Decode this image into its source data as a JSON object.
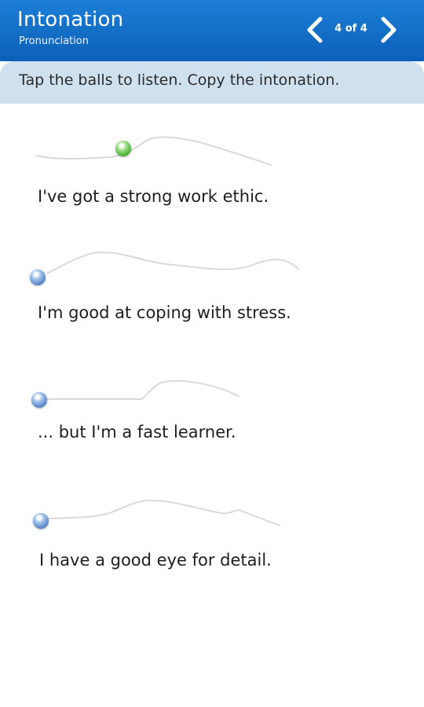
{
  "header": {
    "title": "Intonation",
    "subtitle": "Pronunciation",
    "page_count": "4 of 4"
  },
  "instruction": "Tap the balls to listen. Copy the intonation.",
  "items": [
    {
      "text": "I've got a strong work ethic.",
      "ball_color": "green"
    },
    {
      "text": "I'm good at coping with stress.",
      "ball_color": "blue"
    },
    {
      "text": "... but I'm a fast learner.",
      "ball_color": "blue"
    },
    {
      "text": "I have a good eye for detail.",
      "ball_color": "blue"
    }
  ],
  "colors": {
    "header": "#1269c7",
    "instruction_bar": "#cfe0ef",
    "ball_blue": "#4f7fc4",
    "ball_green": "#3eaa2e"
  }
}
